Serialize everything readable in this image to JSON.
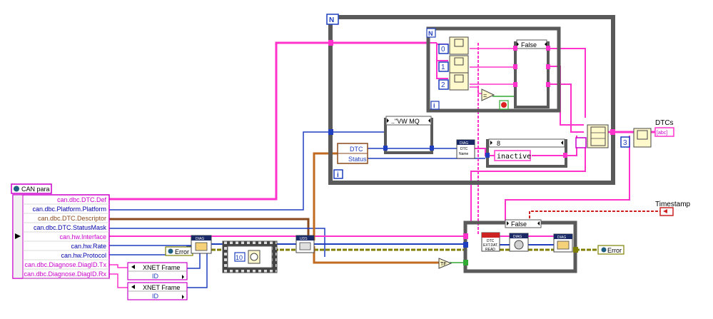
{
  "colors": {
    "pink_wire": "#ff33cc",
    "blue_wire": "#1f3fbf",
    "brown_wire": "#8a4a1c",
    "orange_wire": "#c06a20",
    "green_wire": "#33aa33",
    "olive_wire": "#808000",
    "red_wire": "#cc2222",
    "frame_gray": "#5a5a5a",
    "node_fill": "#fff9cc",
    "cluster_magenta": "#cc00cc"
  },
  "cluster_control": {
    "label": "CAN para",
    "icon": "cluster-icon"
  },
  "unbundle": {
    "items": [
      {
        "label": "can.dbc.DTC.Def",
        "color": "#cc00cc"
      },
      {
        "label": "can.dbc.Platform.Platform",
        "color": "#0000aa"
      },
      {
        "label": "can.dbc.DTC.Descriptor",
        "color": "#8a4a1c"
      },
      {
        "label": "can.dbc.DTC.StatusMask",
        "color": "#0000aa"
      },
      {
        "label": "can.hw.Interface",
        "color": "#cc00cc"
      },
      {
        "label": "can.hw.Rate",
        "color": "#0000aa"
      },
      {
        "label": "can.hw.Protocol",
        "color": "#0000aa"
      },
      {
        "label": "can.dbc.Diagnose.DiagID.Tx",
        "color": "#cc00cc"
      },
      {
        "label": "can.dbc.Diagnose.DiagID.Rx",
        "color": "#cc00cc"
      }
    ]
  },
  "xnet_bundles": [
    {
      "title": "XNET Frame",
      "field": "ID"
    },
    {
      "title": "XNET Frame",
      "field": "ID"
    }
  ],
  "error_in": {
    "label": "Error"
  },
  "error_out": {
    "label": "Error"
  },
  "timestamp": {
    "label": "Timestamp"
  },
  "dtcs": {
    "label": "DTCs",
    "icon_text": "[abc]"
  },
  "for_loop": {
    "n_label": "N",
    "i_label": "i"
  },
  "inner_loop": {
    "n_label": "N",
    "i_label": "i",
    "indices": [
      "0",
      "1",
      "2"
    ]
  },
  "case_false_top": {
    "selector": "False"
  },
  "case_vw": {
    "selector": "..\"VW MQ"
  },
  "case_8": {
    "selector": "8"
  },
  "inactive_const": {
    "value": "inactive"
  },
  "dtc_unbundle": {
    "items": [
      "DTC",
      "Status"
    ]
  },
  "diag_dtc_name": {
    "lines": [
      "DIAG",
      "DTC",
      "Name"
    ]
  },
  "uds_node": {
    "label": "UDS"
  },
  "diag_open": {
    "label": "DIAG"
  },
  "constant_10": {
    "value": "10"
  },
  "case_false_bottom": {
    "selector": "False"
  },
  "dtc_read_node": {
    "lines": [
      "DTC",
      "EXT.DAT.",
      "READ"
    ]
  },
  "diag_mid": {
    "label": "DIAG"
  },
  "diag_close": {
    "label": "DIAG"
  },
  "index_const_3": {
    "value": "3"
  },
  "tf_label": "TF"
}
